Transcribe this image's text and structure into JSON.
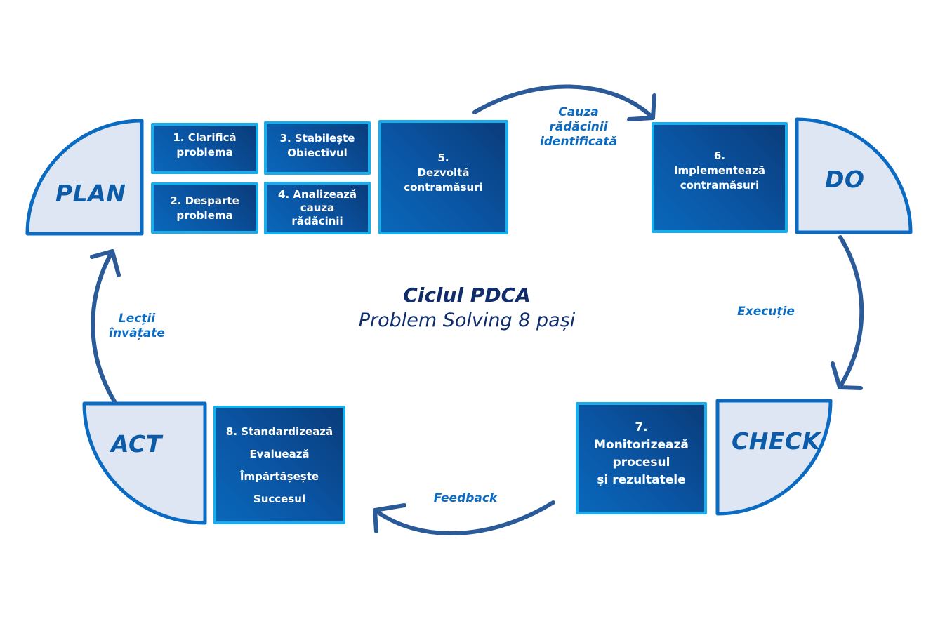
{
  "title": {
    "main": "Ciclul PDCA",
    "subtitle": "Problem Solving 8 pași"
  },
  "colors": {
    "phase_fill": "#dde6f2",
    "phase_stroke": "#0b6bc2",
    "phase_text": "#0b5ba8",
    "step_border": "#19aeea",
    "step_gradient_dark": "#0a3c7a",
    "step_gradient_light": "#0a67ba",
    "arrow": "#2a5a98",
    "arrow_label": "#0b6bc2",
    "title": "#0f2d6b"
  },
  "phases": {
    "plan": "PLAN",
    "do": "DO",
    "check": "CHECK",
    "act": "ACT"
  },
  "steps": {
    "s1": [
      "1. Clarifică",
      "problema"
    ],
    "s2": [
      "2. Desparte",
      "problema"
    ],
    "s3": [
      "3. Stabilește",
      "Obiectivul"
    ],
    "s4": [
      "4. Analizează",
      "cauza",
      "rădăcinii"
    ],
    "s5": [
      "5.",
      "Dezvoltă",
      "contramăsuri"
    ],
    "s6": [
      "6.",
      "Implementează",
      "contramăsuri"
    ],
    "s7": [
      "7.",
      "Monitorizează",
      "procesul",
      "și rezultatele"
    ],
    "s8": [
      "8. Standardizează",
      "Evaluează",
      "Împărtășește",
      "Succesul"
    ]
  },
  "arrows": {
    "plan_to_do": [
      "Cauza",
      "rădăcinii",
      "identificată"
    ],
    "do_to_check": [
      "Execuție"
    ],
    "check_to_act": [
      "Feedback"
    ],
    "act_to_plan": [
      "Lecții",
      "învățate"
    ]
  }
}
